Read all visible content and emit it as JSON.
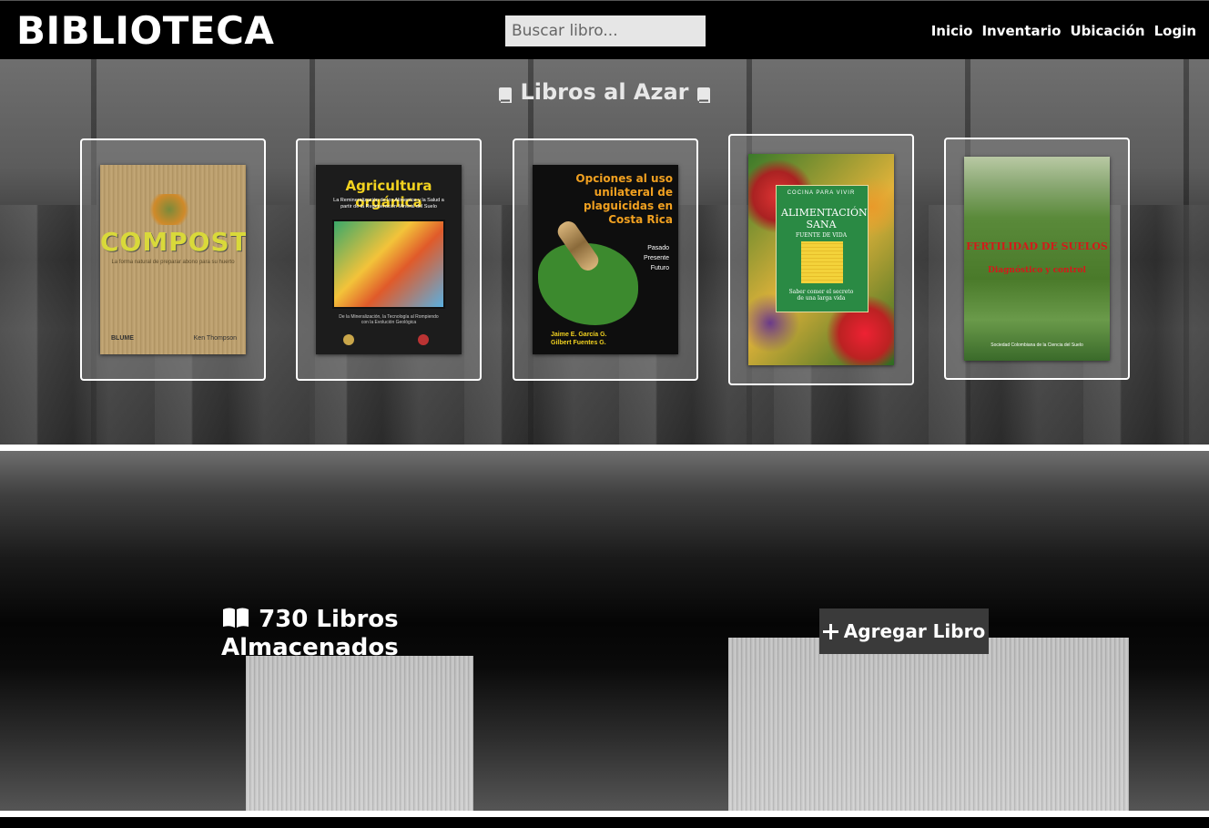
{
  "navbar": {
    "brand": "BIBLIOTECA",
    "search_placeholder": "Buscar libro...",
    "links": [
      "Inicio",
      "Inventario",
      "Ubicación",
      "Login"
    ]
  },
  "random_books": {
    "title": "Libros al Azar",
    "books": [
      {
        "title": "COMPOST",
        "subtitle": "La forma natural de preparar abono para su huerto",
        "publisher": "BLUME",
        "author": "Ken Thompson"
      },
      {
        "title": "Agricultura orgánica",
        "subtitle": "La Remineralización de los Alimentos y la Salud a partir de la Regeneración Mineral del Suelo",
        "footer": "De la Mineralización, la Tecnología al Rompiendo con la Evolución Geológica"
      },
      {
        "title": "Opciones al uso unilateral de plaguicidas en Costa Rica",
        "timeline": [
          "Pasado",
          "Presente",
          "Futuro"
        ],
        "authors": [
          "Jaime E. García G.",
          "Gilbert Fuentes G."
        ]
      },
      {
        "series": "COCINA PARA VIVIR",
        "title": "ALIMENTACIÓN SANA",
        "subtitle": "FUENTE DE VIDA",
        "tagline": "Saber comer el secreto de una larga vida"
      },
      {
        "title": "FERTILIDAD DE SUELOS",
        "subtitle": "Diagnóstico y control",
        "footer": "Sociedad Colombiana de la Ciencia del Suelo"
      }
    ]
  },
  "stats": {
    "count_line1": "730 Libros",
    "count_line2": "Almacenados",
    "add_button": "Agregar Libro"
  }
}
